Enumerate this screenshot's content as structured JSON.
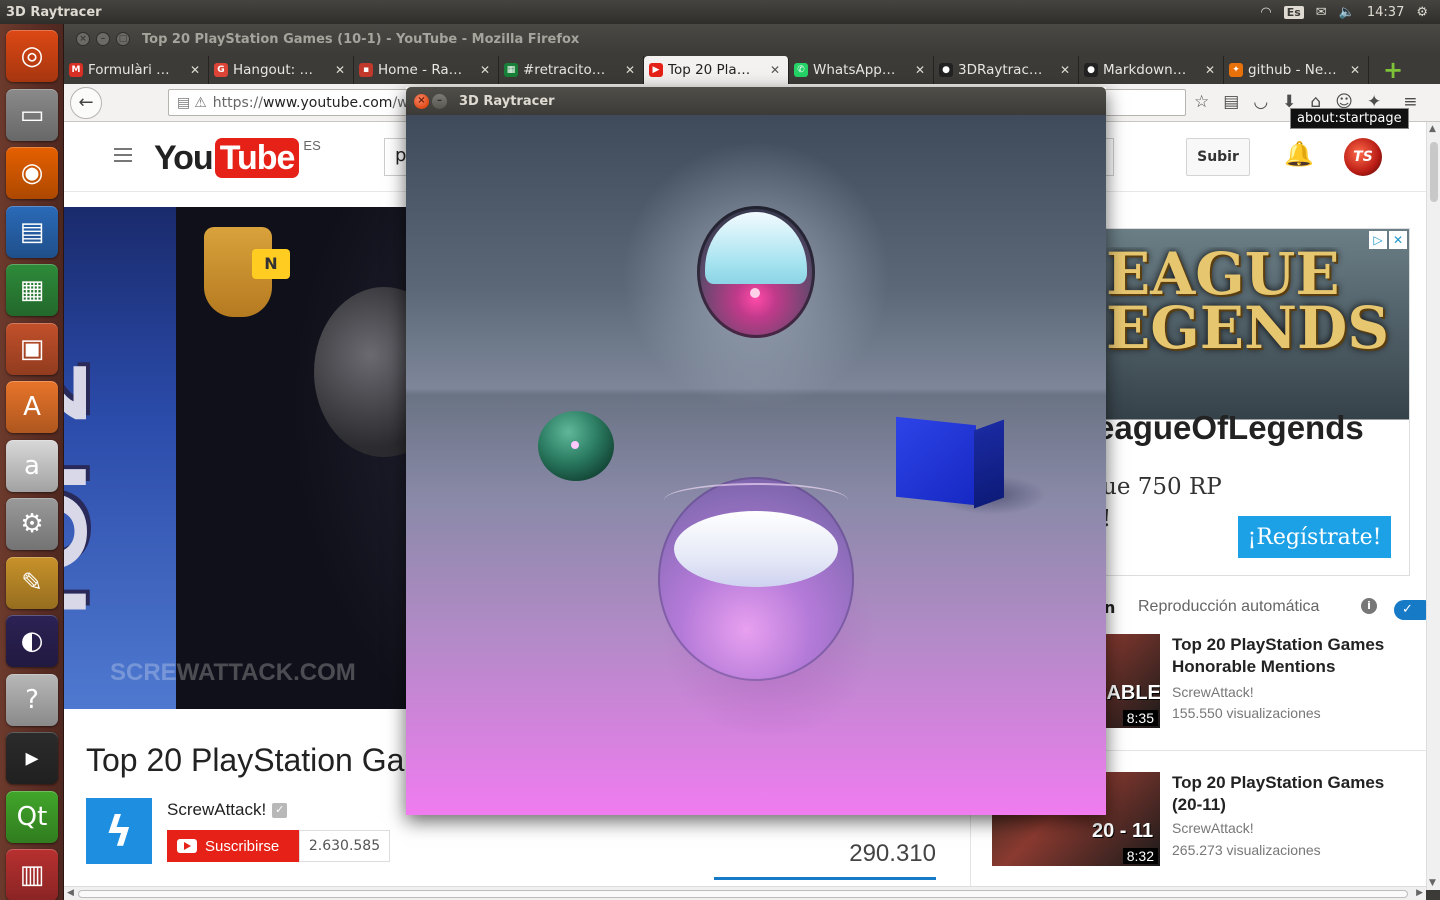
{
  "panel": {
    "title": "3D Raytracer",
    "kbd": "Es",
    "clock": "14:37"
  },
  "firefox": {
    "window_title": "Top 20 PlayStation Games (10-1) - YouTube - Mozilla Firefox",
    "tabs": [
      {
        "label": "Formulàri …",
        "icon_color": "#d93025",
        "icon_glyph": "M"
      },
      {
        "label": "Hangout: …",
        "icon_color": "#db4437",
        "icon_glyph": "G"
      },
      {
        "label": "Home - Ra…",
        "icon_color": "#c0392b",
        "icon_glyph": "▪"
      },
      {
        "label": "#retracito…",
        "icon_color": "#188038",
        "icon_glyph": "▦"
      },
      {
        "label": "Top 20 Pla…",
        "icon_color": "#e62117",
        "icon_glyph": "▶",
        "active": true
      },
      {
        "label": "WhatsApp…",
        "icon_color": "#25d366",
        "icon_glyph": "✆"
      },
      {
        "label": "3DRaytrac…",
        "icon_color": "#222222",
        "icon_glyph": "●"
      },
      {
        "label": "Markdown…",
        "icon_color": "#222222",
        "icon_glyph": "●"
      },
      {
        "label": "github - Ne…",
        "icon_color": "#e8710a",
        "icon_glyph": "✦"
      }
    ],
    "url_prefix": "https://",
    "url_host": "www.youtube.com",
    "url_rest": "/watch?v=E",
    "tooltip": "about:startpage"
  },
  "youtube": {
    "logo_you": "You",
    "logo_tube": "Tube",
    "logo_country": "ES",
    "search_value": "p",
    "upload_label": "Subir",
    "video_title": "Top 20 PlayStation Ga",
    "video_watermark": "SCREWATTACK.COM",
    "video_top2": "TOP2",
    "video_n": "N",
    "channel_name": "ScrewAttack!",
    "subscribe_label": "Suscribirse",
    "subscriber_count": "2.630.585",
    "view_count": "290.310",
    "ad": {
      "logo_line1": "EAGUE",
      "logo_line2": "EGENDS",
      "brand": "eagueOfLegends",
      "text_line1": "ue 750 RP",
      "text_line2": "!",
      "cta": "¡Regístrate!"
    },
    "autoplay_prefix": "n",
    "autoplay_label": "Reproducción automática",
    "related": [
      {
        "title": "Top 20 PlayStation Games Honorable Mentions",
        "channel": "ScrewAttack!",
        "views": "155.550 visualizaciones",
        "duration": "8:35",
        "thumb_text": "RABLE"
      },
      {
        "title": "Top 20 PlayStation Games (20-11)",
        "channel": "ScrewAttack!",
        "views": "265.273 visualizaciones",
        "duration": "8:32",
        "thumb_text": "20 - 11"
      }
    ]
  },
  "raytracer": {
    "title": "3D Raytracer"
  },
  "launcher": [
    {
      "name": "ubuntu-dash-icon",
      "color": "#dd4814",
      "glyph": "◎"
    },
    {
      "name": "files-icon",
      "color": "#8a8a8a",
      "glyph": "▭"
    },
    {
      "name": "firefox-icon",
      "color": "#e66000",
      "glyph": "◉"
    },
    {
      "name": "writer-icon",
      "color": "#2a6ab8",
      "glyph": "▤"
    },
    {
      "name": "calc-icon",
      "color": "#2e8b3a",
      "glyph": "▦"
    },
    {
      "name": "impress-icon",
      "color": "#c2502a",
      "glyph": "▣"
    },
    {
      "name": "software-center-icon",
      "color": "#e8742a",
      "glyph": "A"
    },
    {
      "name": "amazon-icon",
      "color": "#d8d8d8",
      "glyph": "a"
    },
    {
      "name": "settings-icon",
      "color": "#9a9a9a",
      "glyph": "⚙"
    },
    {
      "name": "app-icon",
      "color": "#c8922a",
      "glyph": "✎"
    },
    {
      "name": "eclipse-icon",
      "color": "#2c2255",
      "glyph": "◐"
    },
    {
      "name": "help-icon",
      "color": "#b8b8b8",
      "glyph": "?"
    },
    {
      "name": "terminal-icon",
      "color": "#2b2b2b",
      "glyph": "▸"
    },
    {
      "name": "qt-icon",
      "color": "#41a62a",
      "glyph": "Qt"
    },
    {
      "name": "extra-icon",
      "color": "#b83030",
      "glyph": "▥"
    }
  ]
}
